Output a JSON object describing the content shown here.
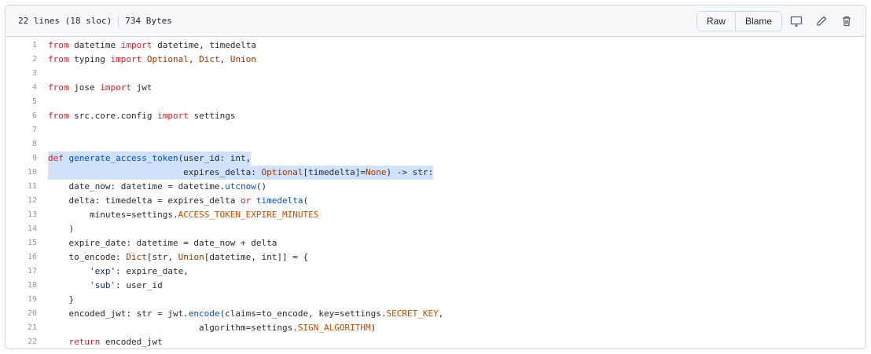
{
  "header": {
    "lines_info": "22 lines (18 sloc)",
    "size": "734 Bytes",
    "raw_label": "Raw",
    "blame_label": "Blame"
  },
  "code": {
    "lines": [
      [
        [
          "kw",
          "from"
        ],
        [
          "t",
          " datetime "
        ],
        [
          "kw",
          "import"
        ],
        [
          "t",
          " datetime, timedelta"
        ]
      ],
      [
        [
          "kw",
          "from"
        ],
        [
          "t",
          " typing "
        ],
        [
          "kw",
          "import"
        ],
        [
          "t",
          " "
        ],
        [
          "cl",
          "Optional"
        ],
        [
          "t",
          ", "
        ],
        [
          "cl",
          "Dict"
        ],
        [
          "t",
          ", "
        ],
        [
          "cl",
          "Union"
        ]
      ],
      [],
      [
        [
          "kw",
          "from"
        ],
        [
          "t",
          " jose "
        ],
        [
          "kw",
          "import"
        ],
        [
          "t",
          " jwt"
        ]
      ],
      [],
      [
        [
          "kw",
          "from"
        ],
        [
          "t",
          " src.core.config "
        ],
        [
          "kw",
          "import"
        ],
        [
          "t",
          " settings"
        ]
      ],
      [],
      [],
      [
        [
          "kw",
          "def"
        ],
        [
          "t",
          " "
        ],
        [
          "nm",
          "generate_access_token"
        ],
        [
          "t",
          "(user_id: int,"
        ]
      ],
      [
        [
          "t",
          "                          expires_delta: "
        ],
        [
          "cl",
          "Optional"
        ],
        [
          "t",
          "[timedelta]="
        ],
        [
          "cl",
          "None"
        ],
        [
          "t",
          ") -> str:"
        ]
      ],
      [
        [
          "t",
          "    date_now: datetime = datetime."
        ],
        [
          "nm",
          "utcnow"
        ],
        [
          "t",
          "()"
        ]
      ],
      [
        [
          "t",
          "    delta: timedelta = expires_delta "
        ],
        [
          "kw",
          "or"
        ],
        [
          "t",
          " "
        ],
        [
          "nm",
          "timedelta"
        ],
        [
          "t",
          "("
        ]
      ],
      [
        [
          "t",
          "        minutes=settings."
        ],
        [
          "cs",
          "ACCESS_TOKEN_EXPIRE_MINUTES"
        ]
      ],
      [
        [
          "t",
          "    )"
        ]
      ],
      [
        [
          "t",
          "    expire_date: datetime = date_now + delta"
        ]
      ],
      [
        [
          "t",
          "    to_encode: "
        ],
        [
          "cl",
          "Dict"
        ],
        [
          "t",
          "[str, "
        ],
        [
          "cl",
          "Union"
        ],
        [
          "t",
          "[datetime, int]] = {"
        ]
      ],
      [
        [
          "t",
          "        "
        ],
        [
          "st",
          "'exp'"
        ],
        [
          "t",
          ": expire_date,"
        ]
      ],
      [
        [
          "t",
          "        "
        ],
        [
          "st",
          "'sub'"
        ],
        [
          "t",
          ": user_id"
        ]
      ],
      [
        [
          "t",
          "    }"
        ]
      ],
      [
        [
          "t",
          "    encoded_jwt: str = jwt."
        ],
        [
          "nm",
          "encode"
        ],
        [
          "t",
          "(claims=to_encode, key=settings."
        ],
        [
          "cs",
          "SECRET_KEY"
        ],
        [
          "t",
          ","
        ]
      ],
      [
        [
          "t",
          "                             algorithm=settings."
        ],
        [
          "cs",
          "SIGN_ALGORITHM"
        ],
        [
          "t",
          ")"
        ]
      ],
      [
        [
          "t",
          "    "
        ],
        [
          "kw",
          "return"
        ],
        [
          "t",
          " encoded_jwt"
        ]
      ]
    ],
    "highlighted_lines": [
      9,
      10
    ]
  },
  "icons": [
    "desktop-icon",
    "pencil-icon",
    "trash-icon"
  ]
}
